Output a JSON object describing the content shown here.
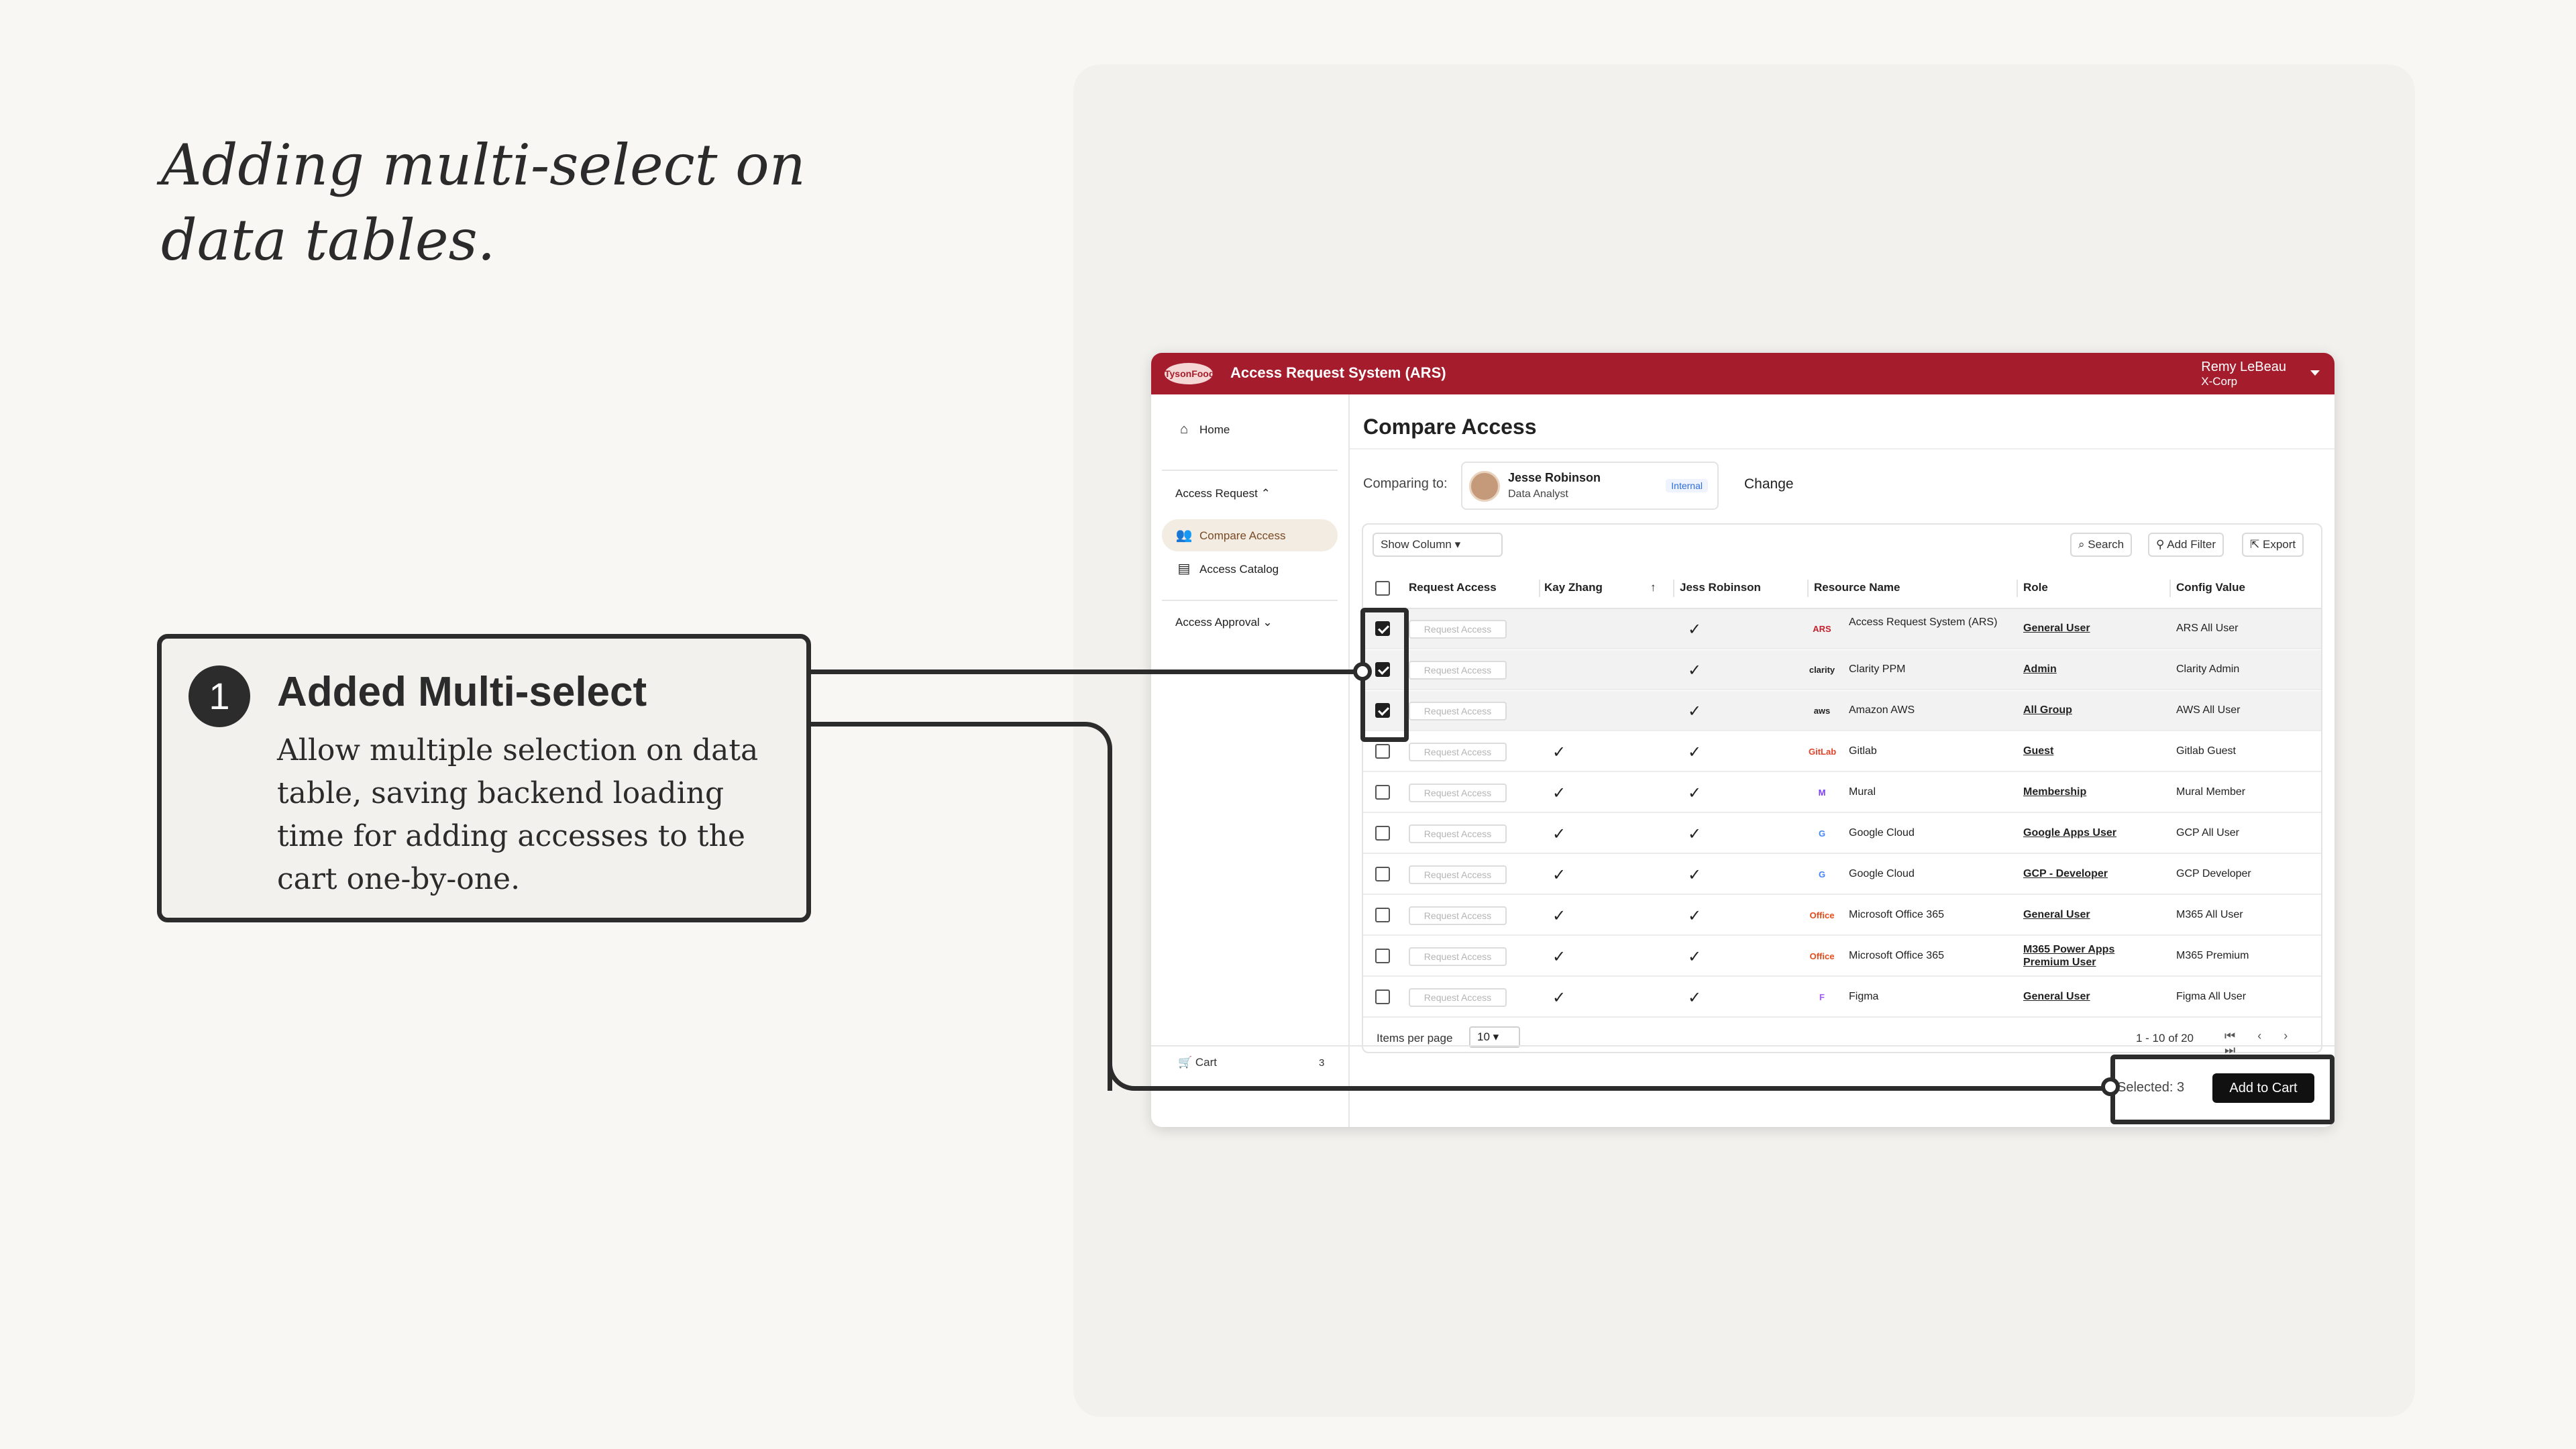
{
  "headline": "Adding multi-select on data tables.",
  "callout": {
    "number": "1",
    "title": "Added Multi-select",
    "body": "Allow multiple selection on data table, saving backend loading time for adding accesses to the cart one-by-one."
  },
  "app": {
    "logo_text": "TysonFoods",
    "title": "Access Request System (ARS)",
    "user_name": "Remy LeBeau",
    "user_org": "X-Corp",
    "brand_color": "#a51d2d"
  },
  "sidebar": {
    "home": "Home",
    "access_request": "Access Request",
    "compare_access": "Compare Access",
    "access_catalog": "Access Catalog",
    "access_approval": "Access Approval",
    "cart": "Cart",
    "cart_count": "3"
  },
  "main": {
    "page_title": "Compare Access",
    "comparing_label": "Comparing to:",
    "person_name": "Jesse Robinson",
    "person_role": "Data Analyst",
    "person_badge": "Internal",
    "change": "Change"
  },
  "toolbar": {
    "show_column": "Show Column",
    "search": "Search",
    "add_filter": "Add Filter",
    "export": "Export"
  },
  "table": {
    "headers": {
      "request_access": "Request Access",
      "kay": "Kay Zhang",
      "jess": "Jess Robinson",
      "resource": "Resource Name",
      "role": "Role",
      "config": "Config Value"
    },
    "request_btn": "Request Access",
    "check_glyph": "✓",
    "rows": [
      {
        "selected": true,
        "kay": "",
        "jess": "✓",
        "logo": "ARS",
        "resource": "Access Request System (ARS)",
        "role": "General User",
        "config": "ARS All User"
      },
      {
        "selected": true,
        "kay": "",
        "jess": "✓",
        "logo": "clarity",
        "resource": "Clarity PPM",
        "role": "Admin",
        "config": "Clarity Admin"
      },
      {
        "selected": true,
        "kay": "",
        "jess": "✓",
        "logo": "aws",
        "resource": "Amazon AWS",
        "role": "All Group",
        "config": "AWS All User"
      },
      {
        "selected": false,
        "kay": "✓",
        "jess": "✓",
        "logo": "GitLab",
        "resource": "Gitlab",
        "role": "Guest",
        "config": "Gitlab Guest"
      },
      {
        "selected": false,
        "kay": "✓",
        "jess": "✓",
        "logo": "M",
        "resource": "Mural",
        "role": "Membership",
        "config": "Mural Member"
      },
      {
        "selected": false,
        "kay": "✓",
        "jess": "✓",
        "logo": "G",
        "resource": "Google Cloud",
        "role": "Google Apps User",
        "config": "GCP All User"
      },
      {
        "selected": false,
        "kay": "✓",
        "jess": "✓",
        "logo": "G",
        "resource": "Google Cloud",
        "role": "GCP - Developer",
        "config": "GCP Developer"
      },
      {
        "selected": false,
        "kay": "✓",
        "jess": "✓",
        "logo": "Office",
        "resource": "Microsoft Office 365",
        "role": "General User",
        "config": "M365 All User"
      },
      {
        "selected": false,
        "kay": "✓",
        "jess": "✓",
        "logo": "Office",
        "resource": "Microsoft Office 365",
        "role": "M365 Power Apps Premium User",
        "config": "M365 Premium"
      },
      {
        "selected": false,
        "kay": "✓",
        "jess": "✓",
        "logo": "F",
        "resource": "Figma",
        "role": "General User",
        "config": "Figma All User"
      }
    ],
    "items_per_page_label": "Items per page",
    "items_per_page": "10",
    "range": "1 - 10 of 20",
    "pager": "⏮ ‹ › ⏭"
  },
  "footer": {
    "selected": "Selected: 3",
    "add_to_cart": "Add to Cart"
  }
}
